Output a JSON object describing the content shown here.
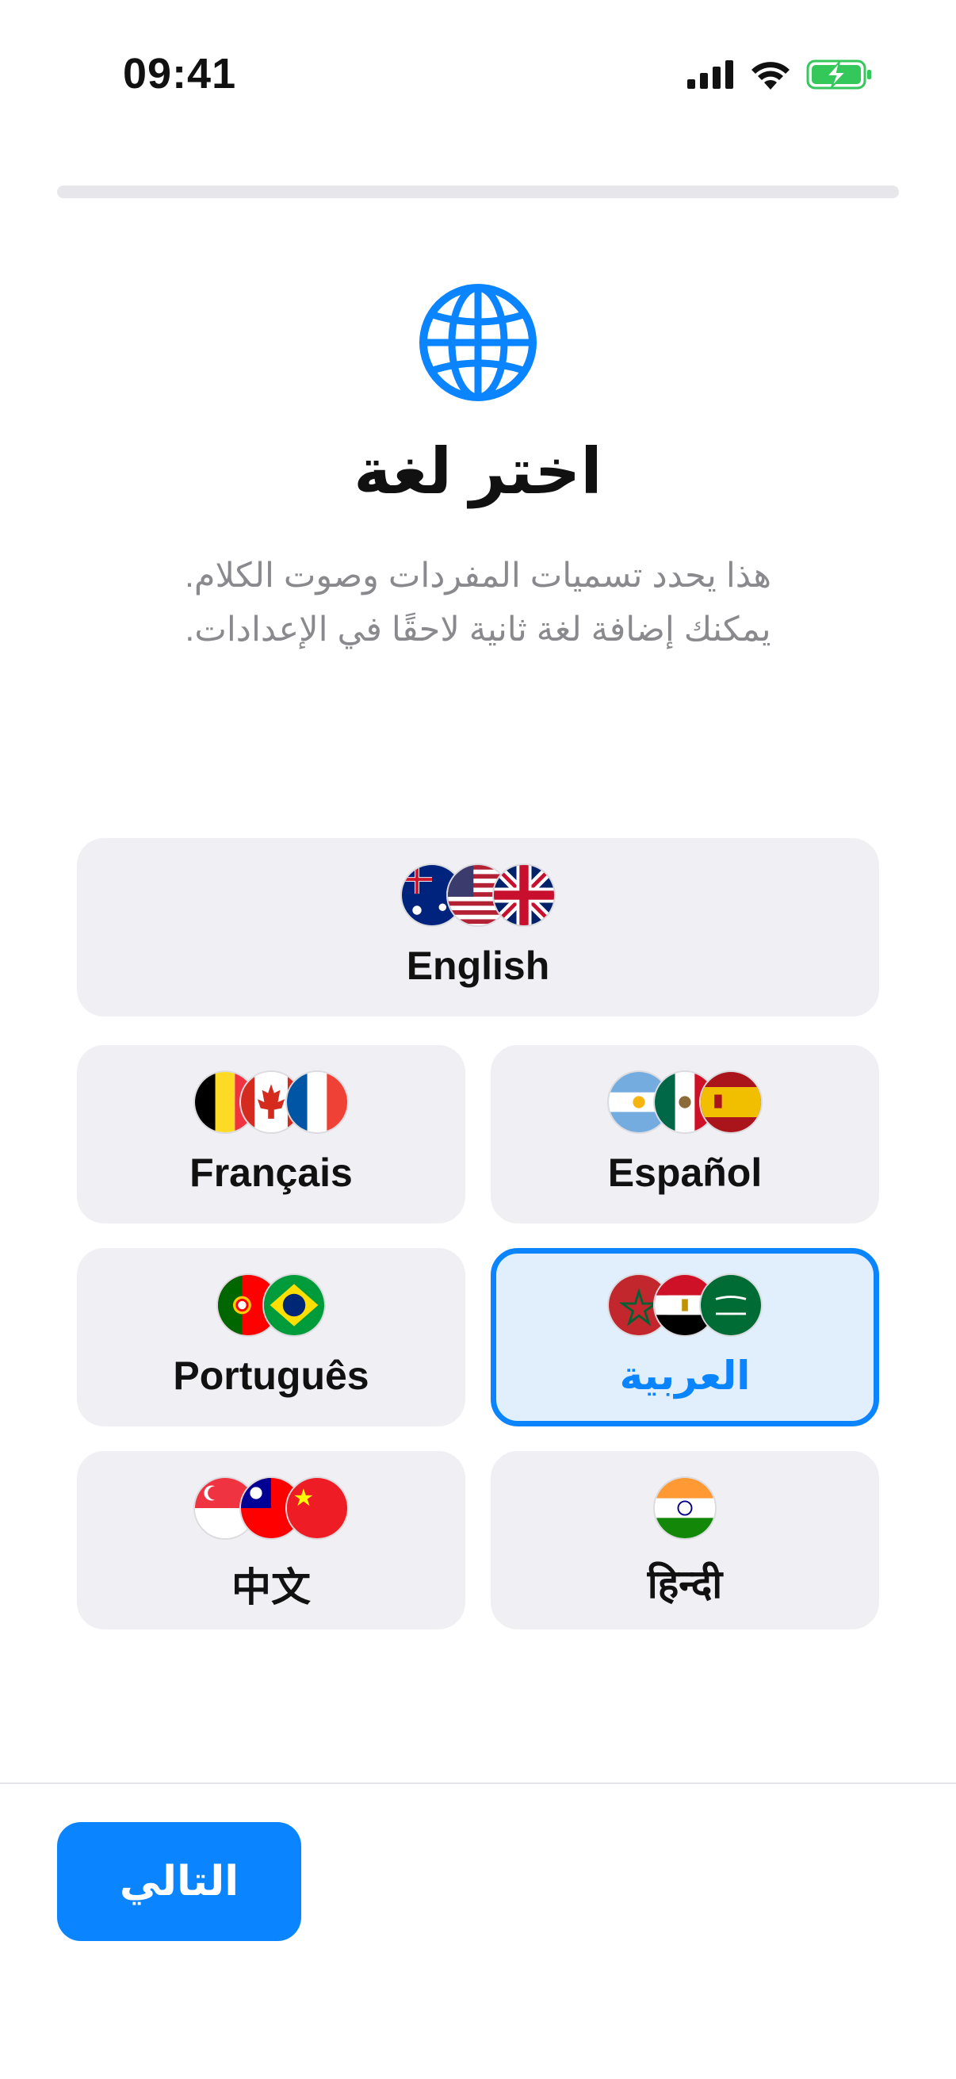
{
  "status_bar": {
    "time": "09:41"
  },
  "progress": {
    "value": 0.0
  },
  "header": {
    "title": "اختر لغة",
    "subtitle_line1": "هذا يحدد تسميات المفردات وصوت الكلام.",
    "subtitle_line2": "يمكنك إضافة لغة ثانية لاحقًا في الإعدادات."
  },
  "languages": [
    {
      "label": "English",
      "flags": [
        "australia-flag-icon",
        "usa-flag-icon",
        "uk-flag-icon"
      ],
      "selected": false
    },
    {
      "label": "Français",
      "flags": [
        "belgium-flag-icon",
        "canada-flag-icon",
        "france-flag-icon"
      ],
      "selected": false
    },
    {
      "label": "Español",
      "flags": [
        "argentina-flag-icon",
        "mexico-flag-icon",
        "spain-flag-icon"
      ],
      "selected": false
    },
    {
      "label": "Português",
      "flags": [
        "portugal-flag-icon",
        "brazil-flag-icon"
      ],
      "selected": false
    },
    {
      "label": "العربية",
      "flags": [
        "morocco-flag-icon",
        "egypt-flag-icon",
        "saudi-flag-icon"
      ],
      "selected": true
    },
    {
      "label": "中文",
      "flags": [
        "singapore-flag-icon",
        "taiwan-flag-icon",
        "china-flag-icon"
      ],
      "selected": false
    },
    {
      "label": "हिन्दी",
      "flags": [
        "india-flag-icon"
      ],
      "selected": false
    }
  ],
  "footer": {
    "next_label": "التالي"
  },
  "colors": {
    "accent": "#0a84ff",
    "card_bg": "#f0f0f4",
    "selected_bg": "#e1eefb",
    "battery": "#34c759"
  }
}
